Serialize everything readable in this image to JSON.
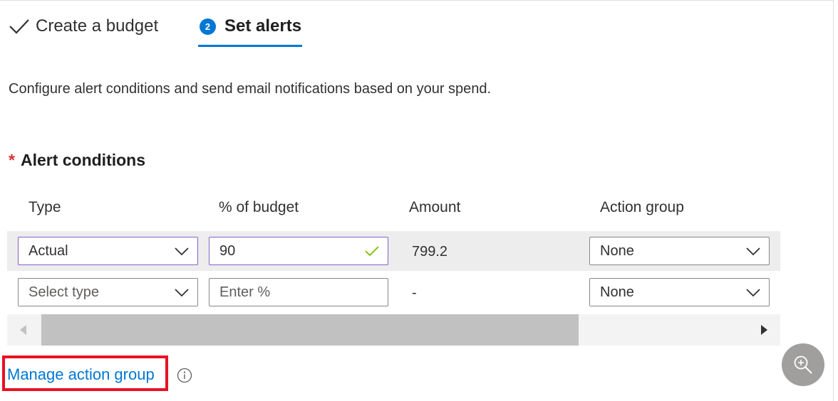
{
  "steps": [
    {
      "label": "Create a budget",
      "state": "completed"
    },
    {
      "number": "2",
      "label": "Set alerts",
      "state": "active"
    }
  ],
  "description": "Configure alert conditions and send email notifications based on your spend.",
  "alert_conditions": {
    "required_marker": "*",
    "title": "Alert conditions",
    "columns": [
      "Type",
      "% of budget",
      "Amount",
      "Action group"
    ],
    "rows": [
      {
        "type": "Actual",
        "percent": "90",
        "amount": "799.2",
        "action_group": "None"
      },
      {
        "type_placeholder": "Select type",
        "percent_placeholder": "Enter %",
        "amount": "-",
        "action_group": "None"
      }
    ]
  },
  "manage_action_group_link": "Manage action group",
  "icons": {
    "completed_step": "checkmark-icon",
    "valid_input": "checkmark-icon",
    "info": "info-icon",
    "zoom": "zoom-in-icon",
    "dropdown": "chevron-down-icon"
  },
  "colors": {
    "accent": "#0078d4",
    "required": "#d13438",
    "valid": "#7fba00",
    "active_border": "#8661c5",
    "highlight": "#e81123"
  }
}
